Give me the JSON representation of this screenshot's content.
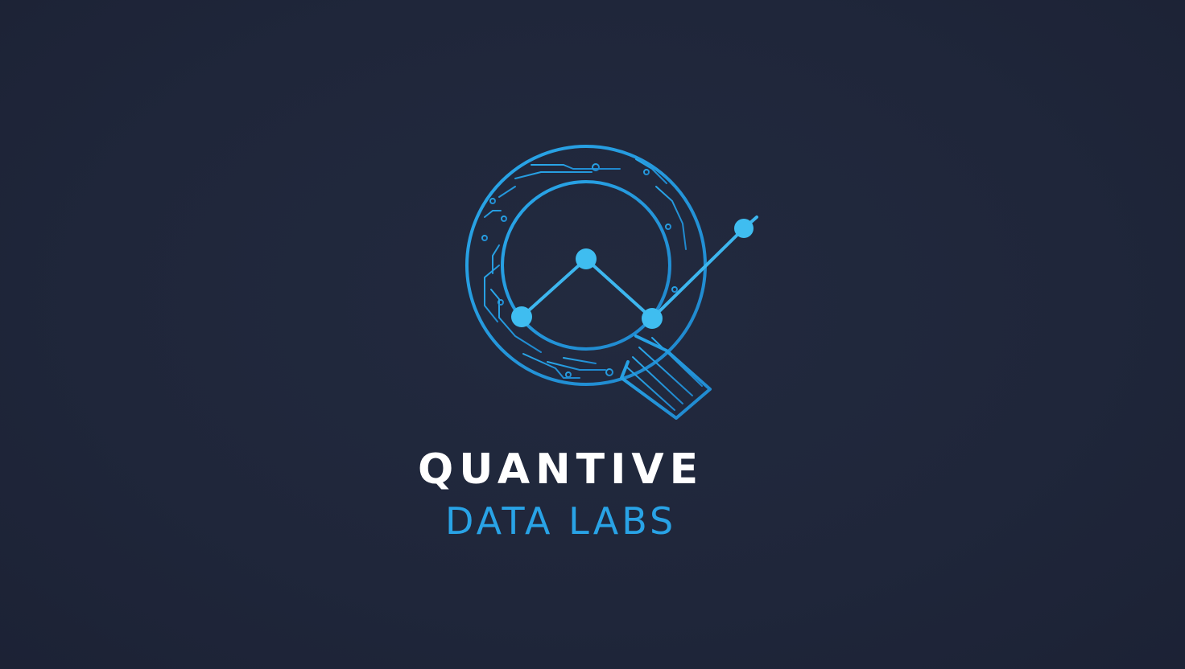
{
  "brand": {
    "name": "QUANTIVE",
    "tagline": "DATA LABS"
  },
  "colors": {
    "background": "#20273b",
    "accent": "#29a3e6",
    "accent_light": "#45bff0",
    "text_primary": "#ffffff"
  },
  "icons": {
    "logo": "magnifier-q-circuit-chart-icon"
  }
}
